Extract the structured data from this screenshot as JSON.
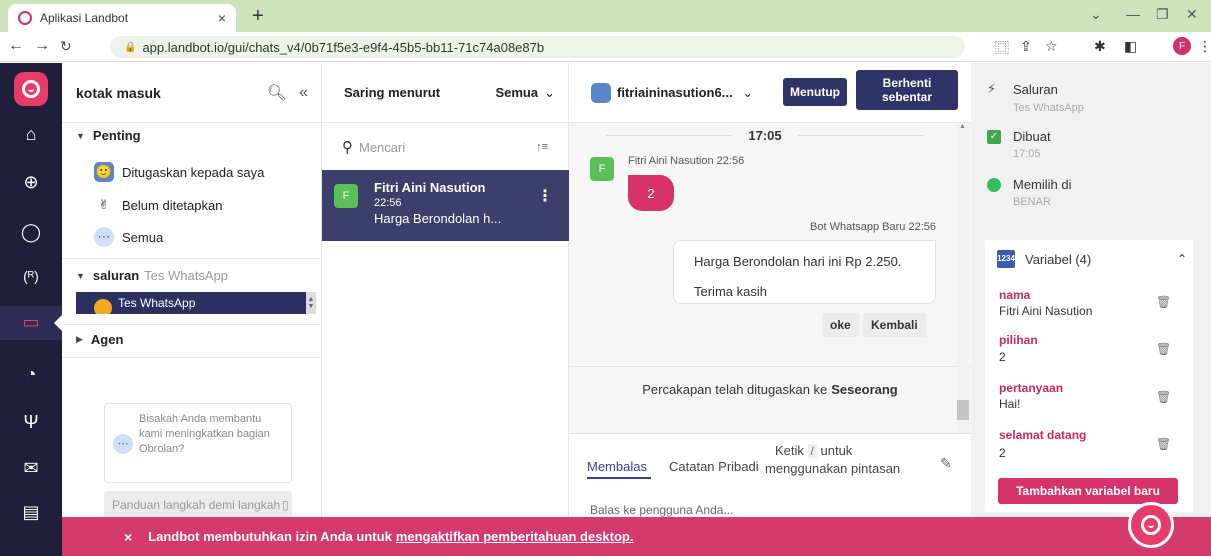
{
  "browser": {
    "tab_title": "Aplikasi Landbot",
    "tab_close": "×",
    "new_tab": "+",
    "url": "app.landbot.io/gui/chats_v4/0b71f5e3-e9f4-45b5-bb11-71c74a08e87b",
    "profile_initial": "F"
  },
  "inbox": {
    "title": "kotak masuk",
    "sections": {
      "important": "Penting",
      "channel_label": "saluran",
      "channel_sub": "Tes WhatsApp",
      "agents": "Agen"
    },
    "items": {
      "assigned": "Ditugaskan kepada saya",
      "unassigned": "Belum ditetapkan",
      "all": "Semua"
    },
    "selected_channel": "Tes WhatsApp",
    "feedback": "Bisakah Anda membantu kami meningkatkan bagian Obrolan?",
    "guide": "Panduan langkah demi langkah"
  },
  "list": {
    "filter_label": "Saring menurut",
    "filter_value": "Semua",
    "search_placeholder": "Mencari",
    "conversation": {
      "avatar": "F",
      "name": "Fitri Aini Nasution",
      "time": "22:56",
      "preview": "Harga Berondolan h..."
    }
  },
  "chat": {
    "contact": "fitriaininasution6...",
    "close_label": "Menutup",
    "pause_label_1": "Berhenti",
    "pause_label_2": "sebentar",
    "time_divider": "17:05",
    "user_avatar": "F",
    "user_name": "Fitri Aini Nasution",
    "user_time": "22:56",
    "user_message": "2",
    "bot_name": "Bot Whatsapp Baru",
    "bot_time": "22:56",
    "bot_line1": "Harga Berondolan hari ini Rp 2.250.",
    "bot_line2": "Terima kasih",
    "quick_reply_1": "oke",
    "quick_reply_2": "Kembali",
    "assigned_text": "Percakapan telah ditugaskan ke",
    "assigned_to": "Seseorang",
    "tab_reply": "Membalas",
    "tab_notes": "Catatan Pribadi",
    "hint_pre": "Ketik",
    "hint_key": "/",
    "hint_post": "untuk menggunakan pintasan",
    "reply_placeholder": "Balas ke pengguna Anda..."
  },
  "details": {
    "channel_label": "Saluran",
    "channel_value": "Tes WhatsApp",
    "created_label": "Dibuat",
    "created_value": "17:05",
    "chosen_label": "Memilih di",
    "chosen_value": "BENAR",
    "variables_title": "Variabel (4)",
    "variables_badge_top": "12",
    "variables_badge_bottom": "34",
    "variables": [
      {
        "name": "nama",
        "value": "Fitri Aini Nasution"
      },
      {
        "name": "pilihan",
        "value": "2"
      },
      {
        "name": "pertanyaan",
        "value": "Hai!"
      },
      {
        "name": "selamat datang",
        "value": "2"
      }
    ],
    "add_variable": "Tambahkan variabel baru"
  },
  "banner": {
    "close": "×",
    "text": "Landbot membutuhkan izin Anda untuk",
    "link": "mengaktifkan pemberitahuan desktop."
  },
  "colors": {
    "brand": "#e73c6a",
    "rail": "#1f1f3a",
    "primary_button": "#2f3466"
  }
}
